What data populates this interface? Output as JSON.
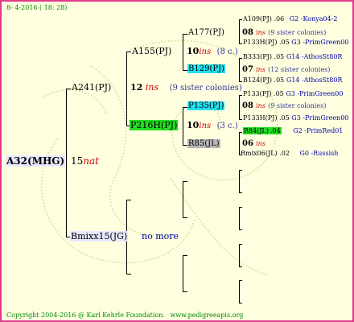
{
  "header": {
    "date": "8- 4-2016 ( 18: 28)"
  },
  "footer": {
    "copyright": "Copyright 2004-2016 @ Karl Kehrle Foundation.",
    "url": "www.pedigreeapis.org"
  },
  "root": {
    "id": "A32(MHG)",
    "num": "15",
    "tag": "nat"
  },
  "gen1": {
    "top": {
      "id": "A241(PJ)",
      "num": "12",
      "tag": "ins",
      "note": "(9 sister colonies)"
    },
    "bottom": {
      "id": "Bmixx15(JG)",
      "note": "no more"
    }
  },
  "gen2": {
    "a": {
      "id": "A155(PJ)",
      "num": "10",
      "tag": "ins",
      "note": "(8 c.)"
    },
    "b": {
      "id": "P216H(PJ)",
      "num": "10",
      "tag": "ins",
      "note": "(3 c.)"
    }
  },
  "gen3": {
    "a": {
      "id": "A177(PJ)",
      "num": "08",
      "tag": "ins",
      "note": "(9 sister colonies)"
    },
    "b": {
      "id": "B129(PJ)",
      "num": "07",
      "tag": "ins",
      "note": "(12 sister colonies)"
    },
    "c": {
      "id": "P135(PJ)",
      "num": "08",
      "tag": "ins",
      "note": "(9 sister colonies)"
    },
    "d": {
      "id": "R85(JL)",
      "num": "06",
      "tag": "ins"
    }
  },
  "gen4": [
    {
      "id": "A109(PJ)",
      "year": ".06",
      "info": "G2 -Konya04-2"
    },
    {
      "id": "P133H(PJ)",
      "year": ".05",
      "info": "G3 -PrimGreen00"
    },
    {
      "id": "B333(PJ)",
      "year": ".05",
      "info": "G14 -AthosSt80R"
    },
    {
      "id": "B124(PJ)",
      "year": ".05",
      "info": "G14 -AthosSt80R"
    },
    {
      "id": "P133(PJ)",
      "year": ".05",
      "info": "G3 -PrimGreen00"
    },
    {
      "id": "P133H(PJ)",
      "year": ".05",
      "info": "G3 -PrimGreen00"
    },
    {
      "id": "R84(JL)",
      "year": ".04",
      "info": "G2 -PrimRed01"
    },
    {
      "id": "Rmix06(JL)",
      "year": ".02",
      "info": "G0 -Russish"
    }
  ]
}
